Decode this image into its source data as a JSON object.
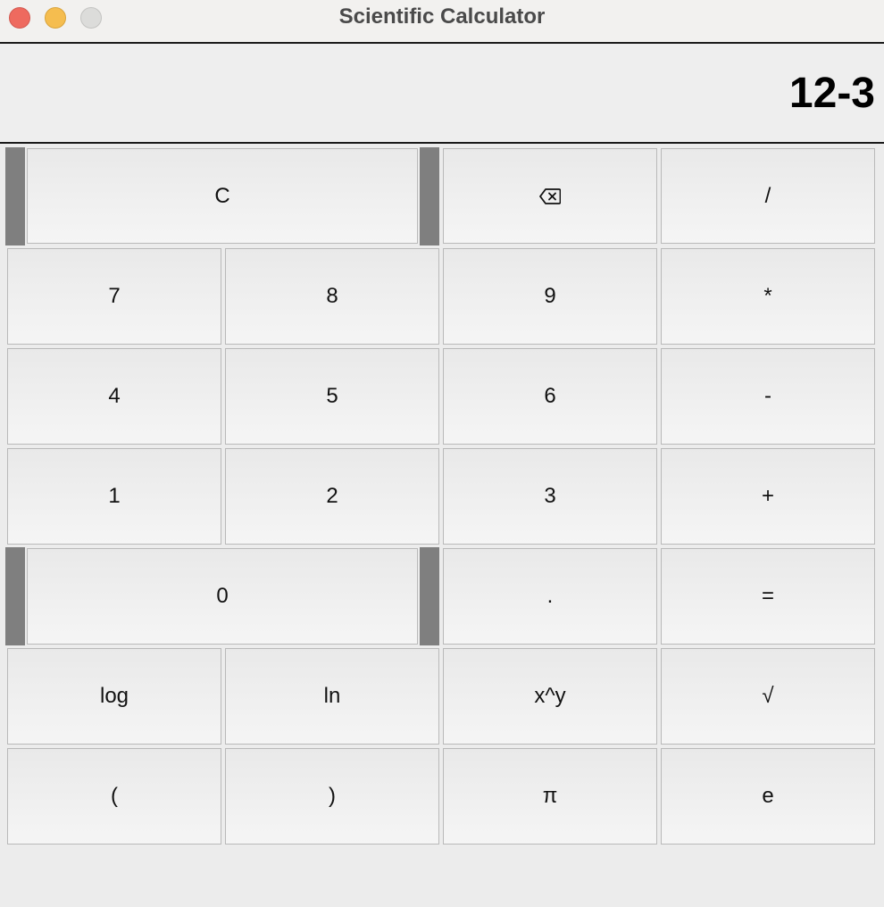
{
  "window": {
    "title": "Scientific Calculator"
  },
  "display": {
    "value": "12-3"
  },
  "buttons": {
    "clear": "C",
    "backspace_icon": "backspace-icon",
    "divide": "/",
    "seven": "7",
    "eight": "8",
    "nine": "9",
    "multiply": "*",
    "four": "4",
    "five": "5",
    "six": "6",
    "subtract": "-",
    "one": "1",
    "two": "2",
    "three": "3",
    "add": "+",
    "zero": "0",
    "decimal": ".",
    "equals": "=",
    "log": "log",
    "ln": "ln",
    "power": "x^y",
    "sqrt": "√",
    "open_paren": "(",
    "close_paren": ")",
    "pi": "π",
    "e": "e"
  },
  "colors": {
    "close": "#ee6a5f",
    "minimize": "#f5bd4f",
    "zoom": "#dcdcda",
    "span_bar": "#7f7f7f"
  }
}
